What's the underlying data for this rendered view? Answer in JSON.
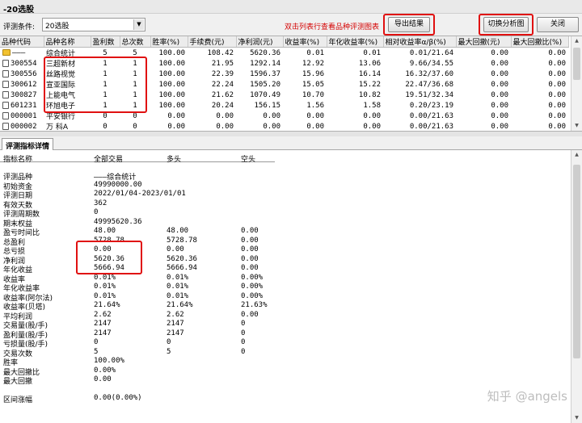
{
  "window": {
    "title": "-20选股"
  },
  "toolbar": {
    "condition_label": "评测条件:",
    "condition_value": "20选股",
    "hint": "双击列表行查看品种评测图表",
    "export_label": "导出结果",
    "switch_label": "切换分析图",
    "close_label": "关闭"
  },
  "grid": {
    "columns": [
      "品种代码",
      "品种名称",
      "盈利数",
      "总次数",
      "胜率(%)",
      "手续费(元)",
      "净利润(元)",
      "收益率(%)",
      "年化收益率(%)",
      "相对收益率α/β(%)",
      "最大回撤(元)",
      "最大回撤比(%)"
    ],
    "rows": [
      [
        "———",
        "综合统计",
        "5",
        "5",
        "100.00",
        "108.42",
        "5620.36",
        "0.01",
        "0.01",
        "0.01/21.64",
        "0.00",
        "0.00"
      ],
      [
        "300554",
        "三超新材",
        "1",
        "1",
        "100.00",
        "21.95",
        "1292.14",
        "12.92",
        "13.06",
        "9.66/34.55",
        "0.00",
        "0.00"
      ],
      [
        "300556",
        "丝路视觉",
        "1",
        "1",
        "100.00",
        "22.39",
        "1596.37",
        "15.96",
        "16.14",
        "16.32/37.60",
        "0.00",
        "0.00"
      ],
      [
        "300612",
        "宣亚国际",
        "1",
        "1",
        "100.00",
        "22.24",
        "1505.20",
        "15.05",
        "15.22",
        "22.47/36.68",
        "0.00",
        "0.00"
      ],
      [
        "300827",
        "上能电气",
        "1",
        "1",
        "100.00",
        "21.62",
        "1070.49",
        "10.70",
        "10.82",
        "19.51/32.34",
        "0.00",
        "0.00"
      ],
      [
        "601231",
        "环旭电子",
        "1",
        "1",
        "100.00",
        "20.24",
        "156.15",
        "1.56",
        "1.58",
        "0.20/23.19",
        "0.00",
        "0.00"
      ],
      [
        "000001",
        "平安银行",
        "0",
        "0",
        "0.00",
        "0.00",
        "0.00",
        "0.00",
        "0.00",
        "0.00/21.63",
        "0.00",
        "0.00"
      ],
      [
        "000002",
        "万 科A",
        "0",
        "0",
        "0.00",
        "0.00",
        "0.00",
        "0.00",
        "0.00",
        "0.00/21.63",
        "0.00",
        "0.00"
      ]
    ]
  },
  "tabs": {
    "detail_label": "评测指标详情"
  },
  "detail": {
    "headers": [
      "指标名称",
      "全部交易",
      "多头",
      "空头"
    ],
    "rows": [
      [
        "评测品种",
        "———综合统计",
        "",
        ""
      ],
      [
        "初始资金",
        "49990000.00",
        "",
        ""
      ],
      [
        "评测日期",
        "2022/01/04-2023/01/01",
        "",
        ""
      ],
      [
        "有效天数",
        "362",
        "",
        ""
      ],
      [
        "评测周期数",
        "0",
        "",
        ""
      ],
      [
        "期末权益",
        "49995620.36",
        "",
        ""
      ],
      [
        "盈亏时间比",
        "48.00",
        "48.00",
        "0.00"
      ],
      [
        "总盈利",
        "5728.78",
        "5728.78",
        "0.00"
      ],
      [
        "总亏损",
        "0.00",
        "0.00",
        "0.00"
      ],
      [
        "净利润",
        "5620.36",
        "5620.36",
        "0.00"
      ],
      [
        "年化收益",
        "5666.94",
        "5666.94",
        "0.00"
      ],
      [
        "收益率",
        "0.01%",
        "0.01%",
        "0.00%"
      ],
      [
        "年化收益率",
        "0.01%",
        "0.01%",
        "0.00%"
      ],
      [
        "收益率(阿尔法)",
        "0.01%",
        "0.01%",
        "0.00%"
      ],
      [
        "收益率(贝塔)",
        "21.64%",
        "21.64%",
        "21.63%"
      ],
      [
        "平均利润",
        "2.62",
        "2.62",
        "0.00"
      ],
      [
        "交易量(股/手)",
        "2147",
        "2147",
        "0"
      ],
      [
        "盈利量(股/手)",
        "2147",
        "2147",
        "0"
      ],
      [
        "亏损量(股/手)",
        "0",
        "0",
        "0"
      ],
      [
        "交易次数",
        "5",
        "5",
        "0"
      ],
      [
        "胜率",
        "100.00%",
        "",
        ""
      ],
      [
        "最大回撤比",
        "0.00%",
        "",
        ""
      ],
      [
        "最大回撤",
        "0.00",
        "",
        ""
      ],
      [
        "",
        "",
        "",
        ""
      ],
      [
        "区间涨幅",
        "0.00(0.00%)",
        "",
        ""
      ]
    ]
  },
  "watermark": "知乎 @angels"
}
